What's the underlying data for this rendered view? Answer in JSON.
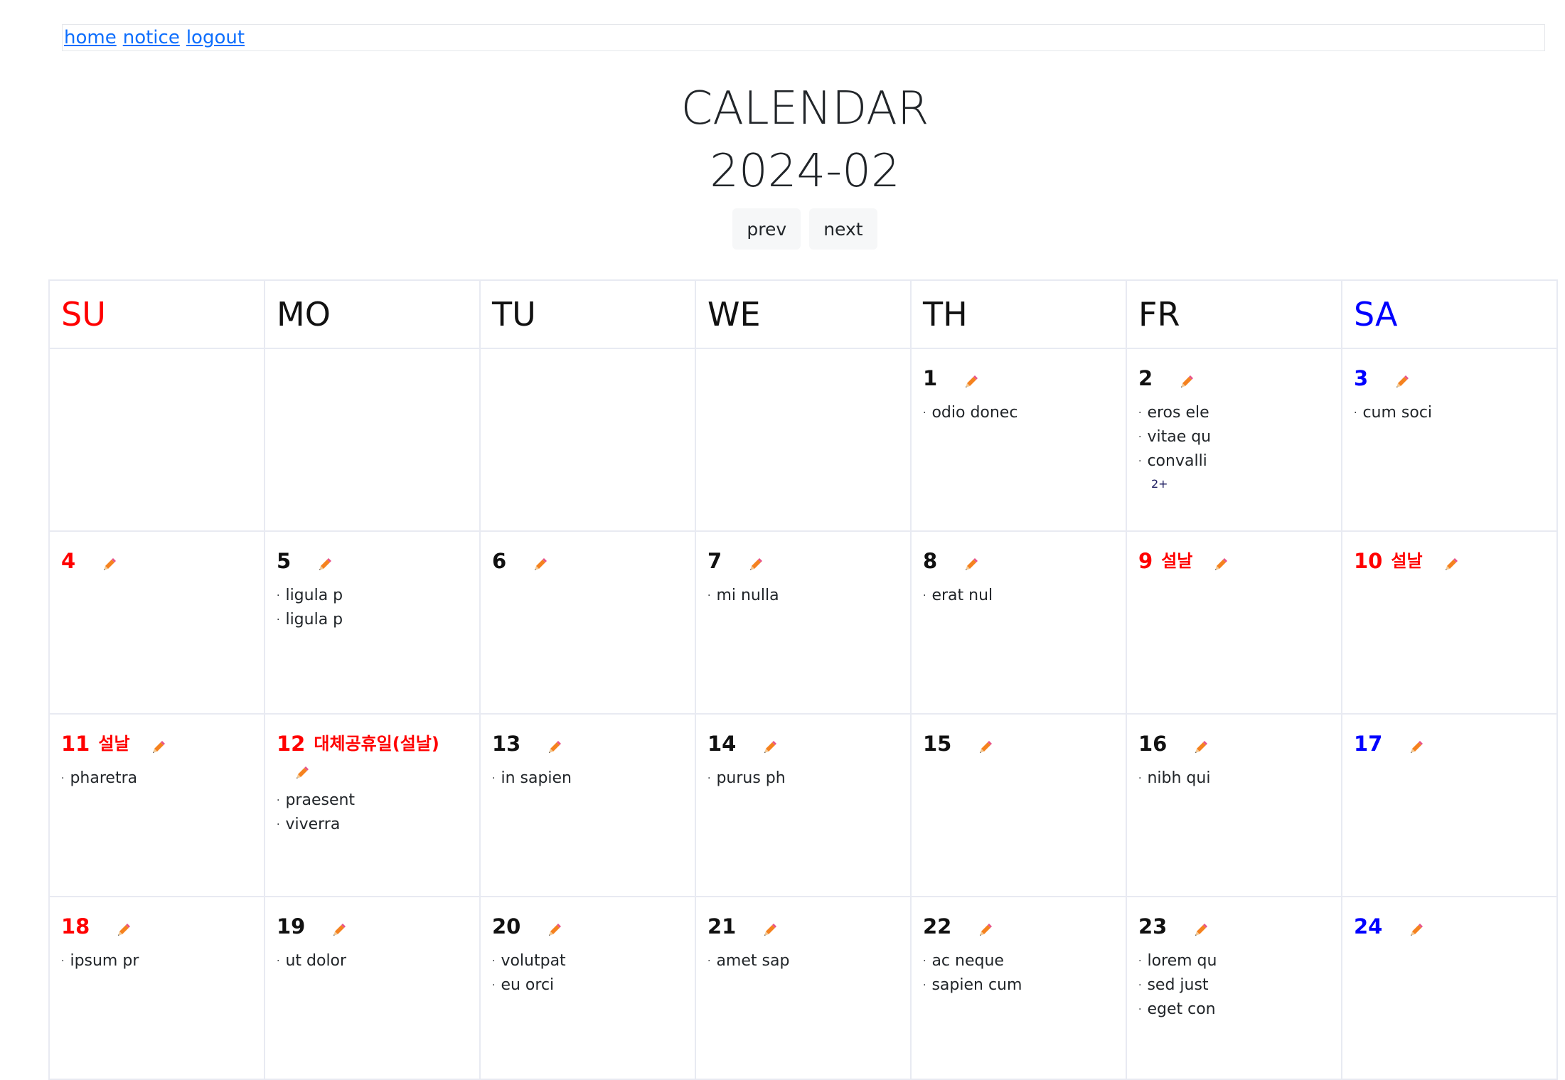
{
  "nav": {
    "links": [
      "home",
      "notice",
      "logout"
    ]
  },
  "calendar": {
    "title": "CALENDAR",
    "month": "2024-02",
    "prev_label": "prev",
    "next_label": "next",
    "weekdays": [
      "SU",
      "MO",
      "TU",
      "WE",
      "TH",
      "FR",
      "SA"
    ],
    "weekday_colors": [
      "#ff0000",
      "#111111",
      "#111111",
      "#111111",
      "#111111",
      "#111111",
      "#0000ff"
    ],
    "edit_icon": "pencil-icon",
    "weeks": [
      [
        null,
        null,
        null,
        null,
        {
          "day": "1",
          "color": "black",
          "holiday": "",
          "events": [
            "odio donec"
          ]
        },
        {
          "day": "2",
          "color": "black",
          "holiday": "",
          "events": [
            "eros ele",
            "vitae qu",
            "convalli"
          ],
          "more": "2+"
        },
        {
          "day": "3",
          "color": "blue",
          "holiday": "",
          "events": [
            "cum soci"
          ]
        }
      ],
      [
        {
          "day": "4",
          "color": "red",
          "holiday": "",
          "events": []
        },
        {
          "day": "5",
          "color": "black",
          "holiday": "",
          "events": [
            "ligula p",
            "ligula p"
          ]
        },
        {
          "day": "6",
          "color": "black",
          "holiday": "",
          "events": []
        },
        {
          "day": "7",
          "color": "black",
          "holiday": "",
          "events": [
            "mi nulla"
          ]
        },
        {
          "day": "8",
          "color": "black",
          "holiday": "",
          "events": [
            "erat nul"
          ]
        },
        {
          "day": "9",
          "color": "red",
          "holiday": "설날",
          "events": []
        },
        {
          "day": "10",
          "color": "red",
          "holiday": "설날",
          "events": []
        }
      ],
      [
        {
          "day": "11",
          "color": "red",
          "holiday": "설날",
          "events": [
            "pharetra"
          ]
        },
        {
          "day": "12",
          "color": "red",
          "holiday": "대체공휴일(설날)",
          "events": [
            "praesent",
            "viverra"
          ],
          "wrap": true
        },
        {
          "day": "13",
          "color": "black",
          "holiday": "",
          "events": [
            "in sapien"
          ]
        },
        {
          "day": "14",
          "color": "black",
          "holiday": "",
          "events": [
            "purus ph"
          ]
        },
        {
          "day": "15",
          "color": "black",
          "holiday": "",
          "events": []
        },
        {
          "day": "16",
          "color": "black",
          "holiday": "",
          "events": [
            "nibh qui"
          ]
        },
        {
          "day": "17",
          "color": "blue",
          "holiday": "",
          "events": []
        }
      ],
      [
        {
          "day": "18",
          "color": "red",
          "holiday": "",
          "events": [
            "ipsum pr"
          ]
        },
        {
          "day": "19",
          "color": "black",
          "holiday": "",
          "events": [
            "ut dolor"
          ]
        },
        {
          "day": "20",
          "color": "black",
          "holiday": "",
          "events": [
            "volutpat",
            "eu orci"
          ]
        },
        {
          "day": "21",
          "color": "black",
          "holiday": "",
          "events": [
            "amet sap"
          ]
        },
        {
          "day": "22",
          "color": "black",
          "holiday": "",
          "events": [
            "ac neque",
            "sapien cum"
          ]
        },
        {
          "day": "23",
          "color": "black",
          "holiday": "",
          "events": [
            "lorem qu",
            "sed just",
            "eget con"
          ]
        },
        {
          "day": "24",
          "color": "blue",
          "holiday": "",
          "events": []
        }
      ]
    ]
  }
}
